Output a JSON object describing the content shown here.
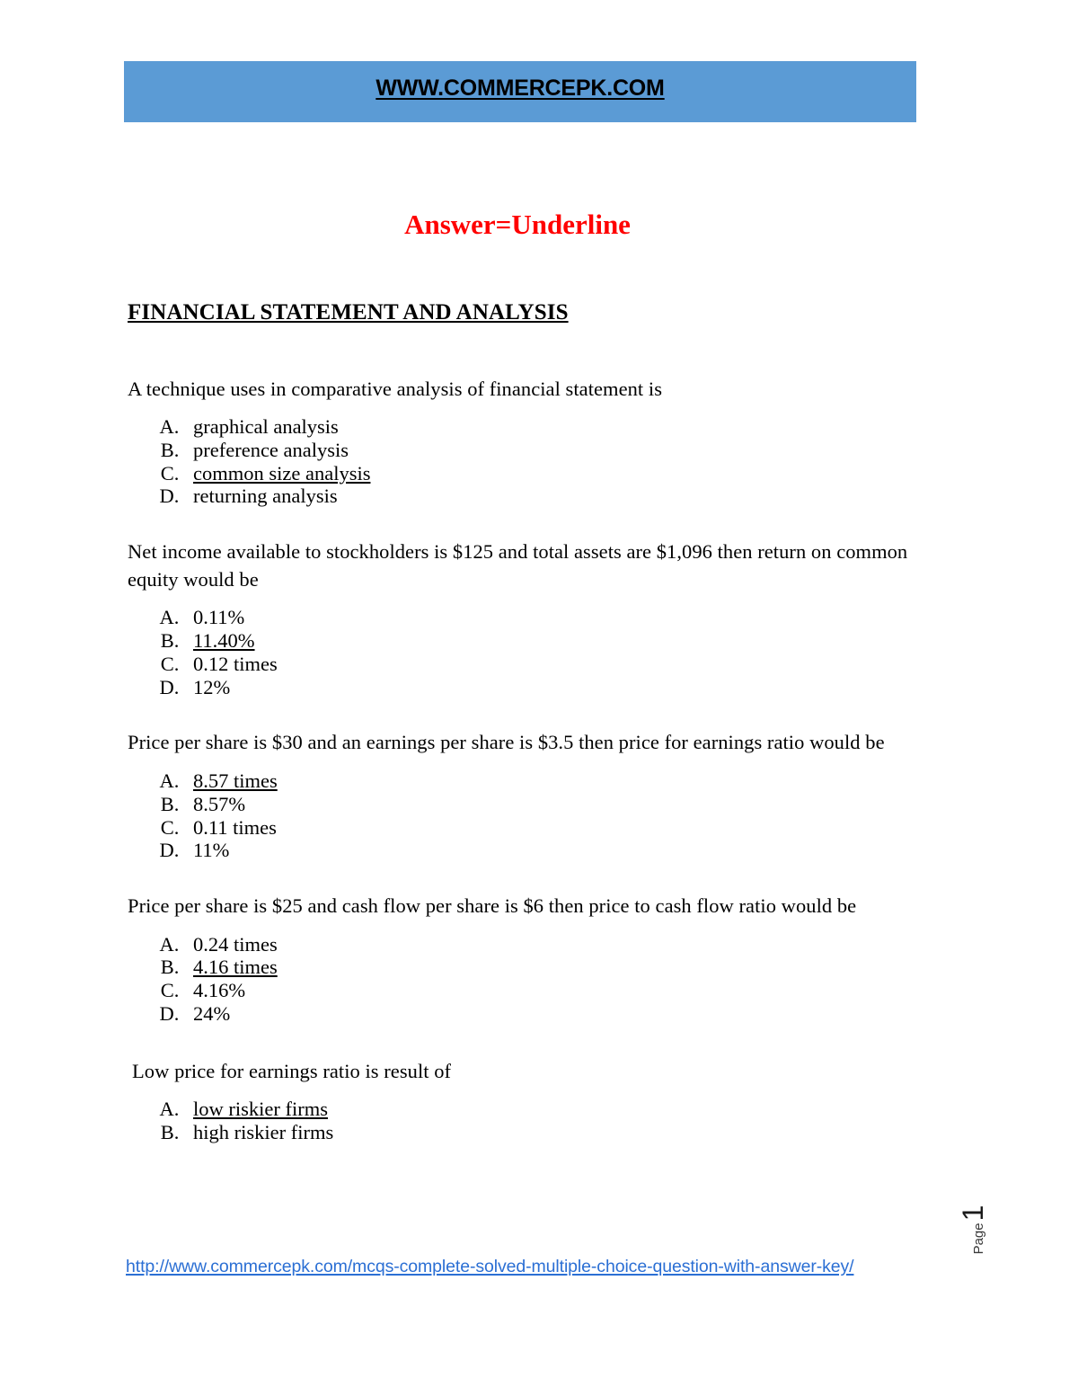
{
  "header": {
    "banner_title": "WWW.COMMERCEPK.COM",
    "banner_color": "#5B9BD5"
  },
  "document": {
    "answer_key_note": "Answer=Underline",
    "answer_key_note_color": "#FF0000",
    "section_heading": "FINANCIAL STATEMENT AND ANALYSIS"
  },
  "questions": [
    {
      "text": "A technique uses in comparative analysis of financial statement is",
      "options": [
        {
          "letter": "A.",
          "text": "graphical analysis",
          "is_answer": false
        },
        {
          "letter": "B.",
          "text": "preference analysis",
          "is_answer": false
        },
        {
          "letter": "C.",
          "text": "common size analysis",
          "is_answer": true
        },
        {
          "letter": "D.",
          "text": "returning analysis",
          "is_answer": false
        }
      ]
    },
    {
      "text": "Net income available to stockholders is $125 and total assets are $1,096 then return on common equity would be",
      "options": [
        {
          "letter": "A.",
          "text": "0.11%",
          "is_answer": false
        },
        {
          "letter": "B.",
          "text": "11.40%",
          "is_answer": true
        },
        {
          "letter": "C.",
          "text": "0.12 times",
          "is_answer": false
        },
        {
          "letter": "D.",
          "text": "12%",
          "is_answer": false
        }
      ]
    },
    {
      "text": "Price per share is $30 and an earnings per share is $3.5 then price for earnings ratio would be",
      "options": [
        {
          "letter": "A.",
          "text": "8.57 times",
          "is_answer": true
        },
        {
          "letter": "B.",
          "text": "8.57%",
          "is_answer": false
        },
        {
          "letter": "C.",
          "text": "0.11 times",
          "is_answer": false
        },
        {
          "letter": "D.",
          "text": "11%",
          "is_answer": false
        }
      ]
    },
    {
      "text": "Price per share is $25 and cash flow per share is $6 then price to cash flow ratio would be",
      "options": [
        {
          "letter": "A.",
          "text": "0.24 times",
          "is_answer": false
        },
        {
          "letter": "B.",
          "text": "4.16 times",
          "is_answer": true
        },
        {
          "letter": "C.",
          "text": "4.16%",
          "is_answer": false
        },
        {
          "letter": "D.",
          "text": "24%",
          "is_answer": false
        }
      ]
    },
    {
      "text": "Low price for earnings ratio is result of",
      "options": [
        {
          "letter": "A.",
          "text": "low riskier firms",
          "is_answer": true
        },
        {
          "letter": "B.",
          "text": "high riskier firms",
          "is_answer": false
        }
      ]
    }
  ],
  "footer": {
    "link_text": "http://www.commercepk.com/mcqs-complete-solved-multiple-choice-question-with-answer-key/",
    "link_color": "#2B6FD4"
  },
  "page_marker": {
    "label": "Page",
    "value": "1"
  }
}
